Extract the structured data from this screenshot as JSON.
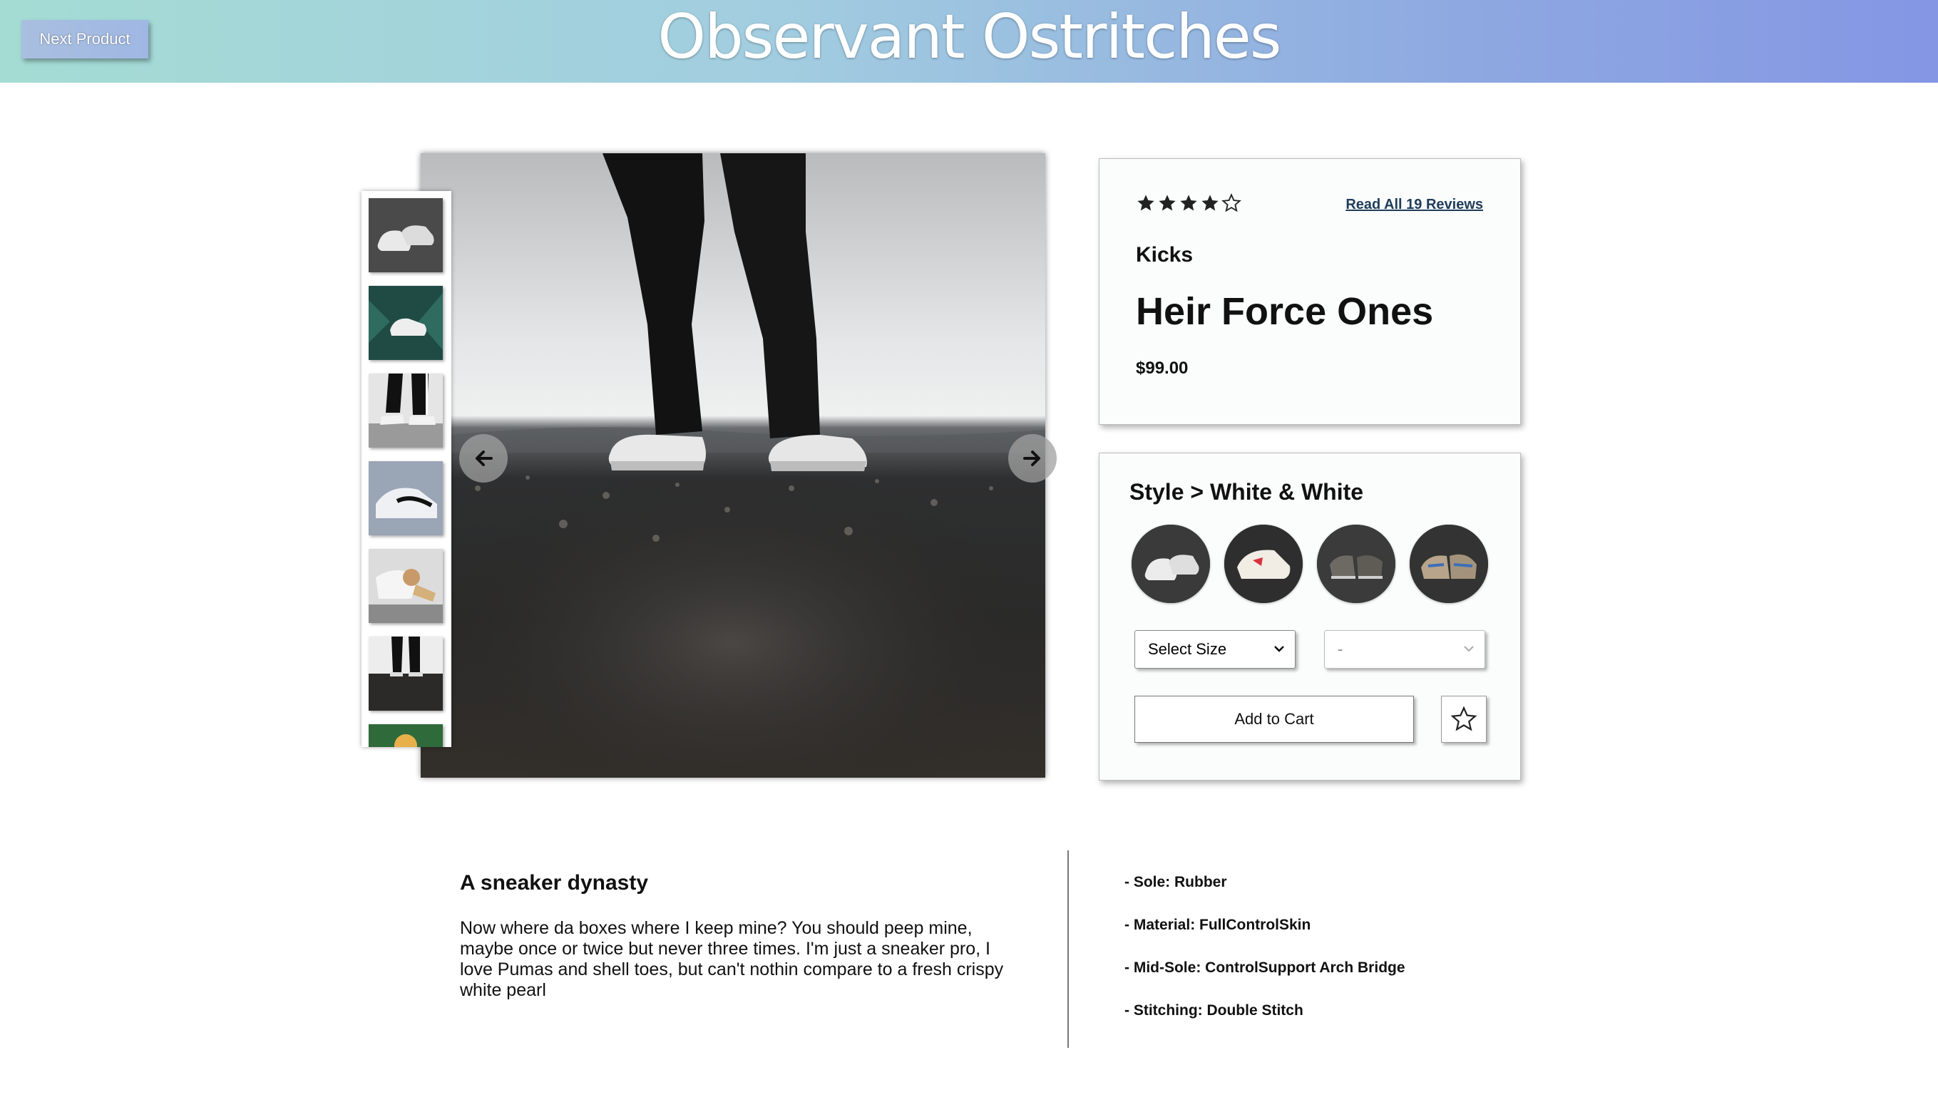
{
  "header": {
    "next_button_label": "Next Product",
    "site_title": "Observant Ostritches"
  },
  "gallery": {
    "thumbnails": [
      {
        "icon": "white-sneakers-grey-bg"
      },
      {
        "icon": "sneaker-on-leaves"
      },
      {
        "icon": "striped-pants-sneakers"
      },
      {
        "icon": "sneaker-closeup"
      },
      {
        "icon": "person-tying-shoe"
      },
      {
        "icon": "legs-on-gravel"
      },
      {
        "icon": "partial-thumbnail"
      }
    ],
    "main_image_icon": "person-standing-white-sneakers",
    "prev_arrow_icon": "arrow-left-icon",
    "next_arrow_icon": "arrow-right-icon"
  },
  "product": {
    "rating": 4,
    "rating_max": 5,
    "reviews_link": "Read All 19 Reviews",
    "category": "Kicks",
    "name": "Heir Force Ones",
    "price": "$99.00"
  },
  "style": {
    "title": "Style > White & White",
    "swatches": [
      "white-white",
      "cream-red",
      "grey-dark",
      "tan-blue"
    ],
    "size_select": "Select Size",
    "qty_select": "-",
    "add_to_cart": "Add to Cart"
  },
  "description": {
    "title": "A sneaker dynasty",
    "text": "Now where da boxes where I keep mine? You should peep mine, maybe once or twice but never three times. I'm just a sneaker pro, I love Pumas and shell toes, but can't nothin compare to a fresh crispy white pearl"
  },
  "features": [
    "- Sole: Rubber",
    "- Material: FullControlSkin",
    "- Mid-Sole: ControlSupport Arch Bridge",
    "- Stitching: Double Stitch"
  ],
  "colors": {
    "header_start": "#a4dcd4",
    "header_end": "#8496e4",
    "link": "#1f3c5a"
  }
}
